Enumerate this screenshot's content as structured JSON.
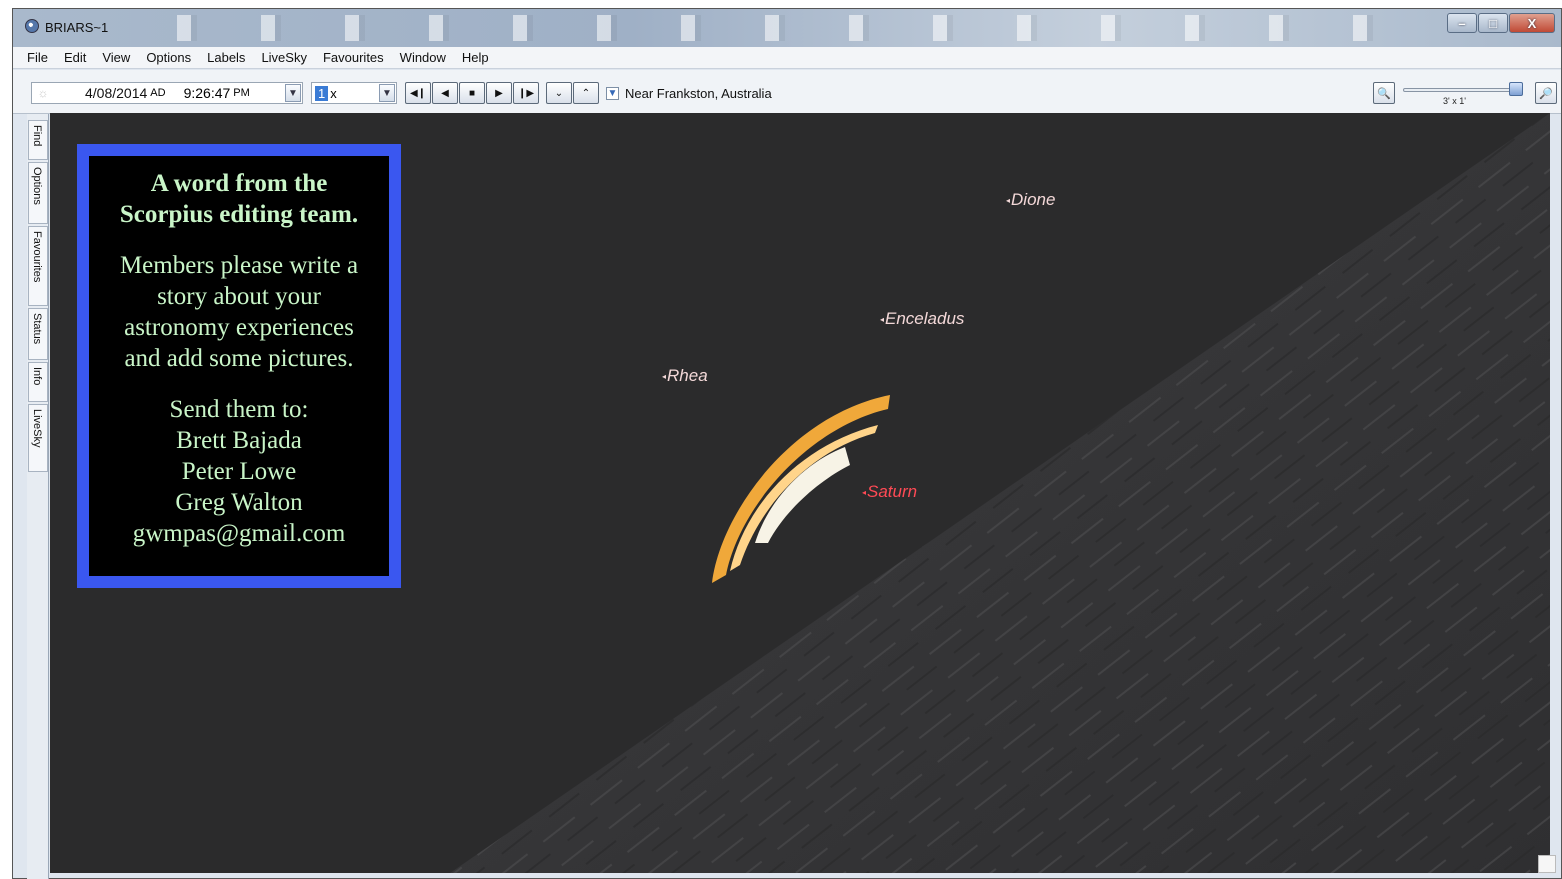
{
  "window": {
    "title": "BRIARS~1",
    "buttons": {
      "minimize": "–",
      "maximize": "□",
      "close": "X"
    }
  },
  "menubar": {
    "items": [
      "File",
      "Edit",
      "View",
      "Options",
      "Labels",
      "LiveSky",
      "Favourites",
      "Window",
      "Help"
    ]
  },
  "toolbar": {
    "date": "4/08/2014",
    "era": "AD",
    "time": "9:26:47",
    "ampm": "PM",
    "speed": "1",
    "speed_unit": "x",
    "location": "Near Frankston, Australia",
    "fov": "3' x 1'",
    "zoom_level": 0.95
  },
  "sidetabs": [
    "Find",
    "Options",
    "Favourites",
    "Status",
    "Info",
    "LiveSky"
  ],
  "notice": {
    "title_line1": "A word from the",
    "title_line2": "Scorpius editing team.",
    "body_lines": [
      "Members please write a",
      "story about your",
      "astronomy experiences",
      "and add some pictures."
    ],
    "send_lines": [
      "Send them to:",
      "Brett Bajada",
      "Peter Lowe",
      "Greg Walton",
      "gwmpas@gmail.com"
    ]
  },
  "sky_labels": {
    "dione": "Dione",
    "enceladus": "Enceladus",
    "rhea": "Rhea",
    "saturn": "Saturn"
  },
  "colors": {
    "notice_border": "#3a57f0",
    "notice_text": "#c9f5c8",
    "saturn_label": "#ff4a55",
    "moon_label": "#f3d8d8"
  }
}
